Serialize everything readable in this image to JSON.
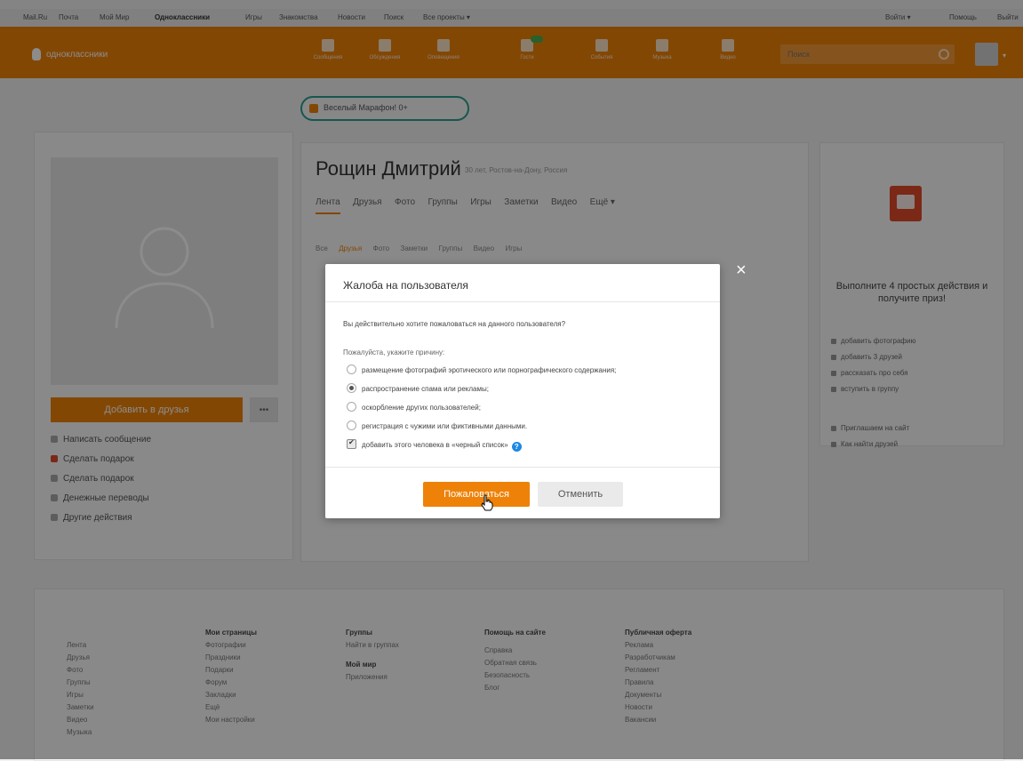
{
  "bookmarks": [
    "Mail.Ru",
    "Почта",
    "Мой Мир",
    "Одноклассники",
    "Игры",
    "Знакомства",
    "Новости",
    "Поиск",
    "Все проекты ▾"
  ],
  "bookmarks_right": [
    "Войти ▾",
    "Помощь",
    "Выйти"
  ],
  "header": {
    "logo_text": "одноклассники",
    "nav": [
      "Сообщения",
      "Обсуждения",
      "Оповещения",
      "Гости",
      "События",
      "Музыка",
      "Видео"
    ],
    "search_placeholder": "Поиск"
  },
  "gift_banner": "Веселый Марафон! 0+",
  "profile": {
    "name": "Рощин Дмитрий",
    "name_sub": "30 лет, Ростов-на-Дону, Россия",
    "tabs": [
      "Лента",
      "Друзья",
      "Фото",
      "Группы",
      "Игры",
      "Заметки",
      "Видео",
      "Ещё ▾"
    ],
    "subtabs": [
      "Все",
      "Друзья",
      "Фото",
      "Заметки",
      "Группы",
      "Видео",
      "Игры"
    ],
    "add_friend": "Добавить в друзья",
    "more": "•••",
    "actions": [
      "Написать сообщение",
      "Сделать подарок",
      "Сделать подарок",
      "Денежные переводы",
      "Другие действия"
    ]
  },
  "right_panel": {
    "title": "Выполните 4 простых действия и получите приз!",
    "tasks": [
      "добавить фотографию",
      "добавить 3 друзей",
      "рассказать про себя",
      "вступить в группу"
    ],
    "extra": [
      "Приглашаем на сайт",
      "Как найти друзей"
    ]
  },
  "footer": {
    "columns": [
      {
        "head": "",
        "links": [
          "Лента",
          "Друзья",
          "Фото",
          "Группы",
          "Игры",
          "Заметки",
          "Видео",
          "Музыка"
        ]
      },
      {
        "head": "Мои страницы",
        "links": [
          "Фотографии",
          "Праздники",
          "Подарки",
          "Форум",
          "Закладки",
          "Ещё",
          "Мои настройки"
        ]
      },
      {
        "head": "Группы",
        "links": [
          "Найти в группах"
        ]
      },
      {
        "head": "Помощь на сайте",
        "links": [
          "Справка",
          "Обратная связь",
          "Безопасность",
          "Блог"
        ]
      },
      {
        "head": "Публичная оферта",
        "links": [
          "Реклама",
          "Разработчикам",
          "Регламент",
          "Правила",
          "Документы",
          "Новости",
          "Вакансии"
        ]
      }
    ],
    "my_apps": "Мой мир",
    "apps_link": "Приложения"
  },
  "dialog": {
    "title": "Жалоба на пользователя",
    "question": "Вы действительно хотите пожаловаться на данного пользователя?",
    "prompt": "Пожалуйста, укажите причину:",
    "options": [
      {
        "label": "размещение фотографий эротического или порнографического содержания;",
        "selected": false
      },
      {
        "label": "распространение спама или рекламы;",
        "selected": true
      },
      {
        "label": "оскорбление других пользователей;",
        "selected": false
      },
      {
        "label": "регистрация с чужими или фиктивными данными."
      }
    ],
    "blacklist_label": "добавить этого человека в «черный список»",
    "blacklist_checked": true,
    "confirm_button": "Пожаловаться",
    "cancel_button": "Отменить",
    "close_symbol": "×"
  }
}
